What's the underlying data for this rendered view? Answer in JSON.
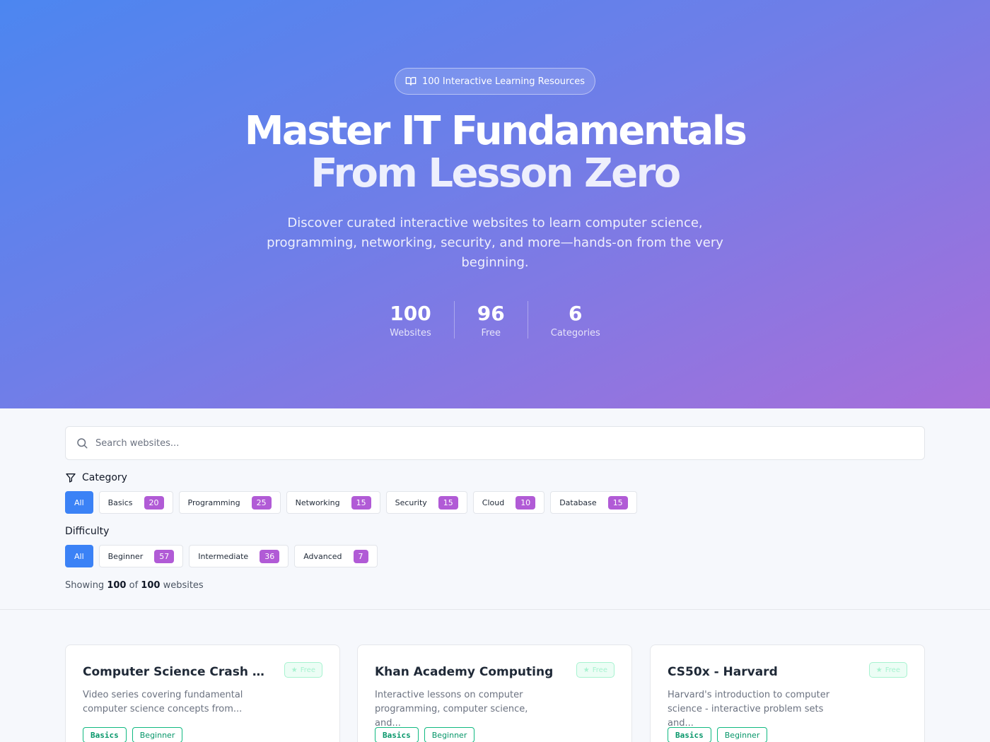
{
  "hero": {
    "badge": "100 Interactive Learning Resources",
    "title_line1": "Master IT Fundamentals",
    "title_line2": "From Lesson Zero",
    "subtitle": "Discover curated interactive websites to learn computer science, programming, networking, security, and more—hands-on from the very beginning.",
    "stats": [
      {
        "value": "100",
        "label": "Websites"
      },
      {
        "value": "96",
        "label": "Free"
      },
      {
        "value": "6",
        "label": "Categories"
      }
    ]
  },
  "search": {
    "placeholder": "Search websites..."
  },
  "category_filter": {
    "title": "Category",
    "chips": [
      {
        "label": "All",
        "count": null,
        "active": true
      },
      {
        "label": "Basics",
        "count": "20"
      },
      {
        "label": "Programming",
        "count": "25"
      },
      {
        "label": "Networking",
        "count": "15"
      },
      {
        "label": "Security",
        "count": "15"
      },
      {
        "label": "Cloud",
        "count": "10"
      },
      {
        "label": "Database",
        "count": "15"
      }
    ]
  },
  "difficulty_filter": {
    "title": "Difficulty",
    "chips": [
      {
        "label": "All",
        "count": null,
        "active": true
      },
      {
        "label": "Beginner",
        "count": "57"
      },
      {
        "label": "Intermediate",
        "count": "36"
      },
      {
        "label": "Advanced",
        "count": "7"
      }
    ]
  },
  "results": {
    "prefix": "Showing",
    "shown": "100",
    "of": "of",
    "total": "100",
    "suffix": "websites"
  },
  "cards": [
    {
      "title": "Computer Science Crash Course",
      "badge": "Free",
      "description": "Video series covering fundamental computer science concepts from...",
      "tags": [
        "Basics",
        "Beginner"
      ]
    },
    {
      "title": "Khan Academy Computing",
      "badge": "Free",
      "description": "Interactive lessons on computer programming, computer science, and...",
      "tags": [
        "Basics",
        "Beginner"
      ]
    },
    {
      "title": "CS50x - Harvard",
      "badge": "Free",
      "description": "Harvard's introduction to computer science - interactive problem sets and...",
      "tags": [
        "Basics",
        "Beginner"
      ]
    }
  ],
  "colors": {
    "accent": "#3b82f6",
    "count_badge": "#b15bd6",
    "tag_green": "#10b981"
  }
}
